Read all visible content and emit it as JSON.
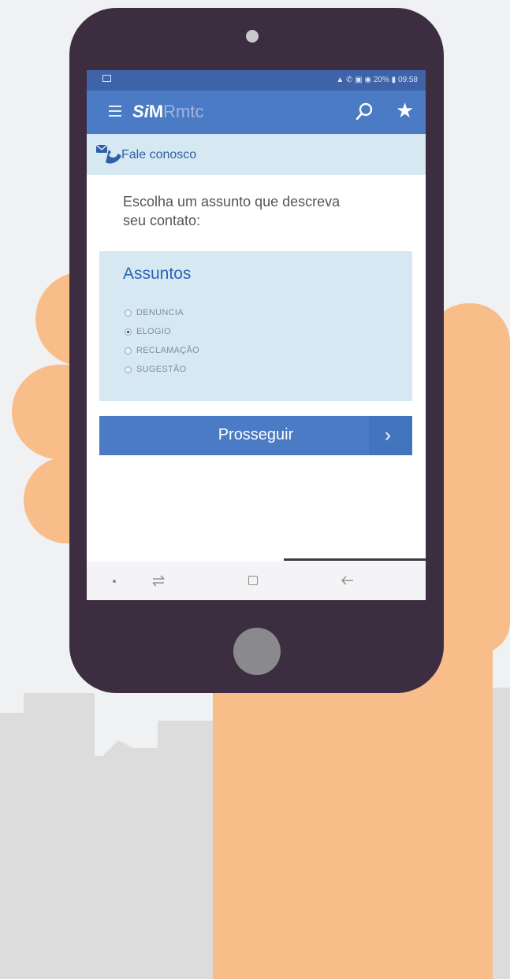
{
  "status_bar": {
    "right_text": "▲ ✆ ▣ ◉ 20% ▮ 09:58"
  },
  "app_bar": {
    "logo_s": "S",
    "logo_i": "i",
    "logo_m": "M",
    "logo_sub": "Rmtc"
  },
  "section": {
    "title": "Fale conosco"
  },
  "prompt": "Escolha um assunto que descreva seu contato:",
  "subjects": {
    "title": "Assuntos",
    "options": [
      {
        "label": "DENUNCIA",
        "selected": false
      },
      {
        "label": "ELOGIO",
        "selected": true
      },
      {
        "label": "RECLAMAÇÃO",
        "selected": false
      },
      {
        "label": "SUGESTÃO",
        "selected": false
      }
    ]
  },
  "proceed_button": {
    "label": "Prosseguir",
    "arrow": "›"
  },
  "colors": {
    "accent": "#4a7bc4",
    "status_bar": "#3f63a8",
    "section_bg": "#d6e8f2",
    "phone_body": "#3d2d40",
    "skin": "#f9bd8a"
  }
}
